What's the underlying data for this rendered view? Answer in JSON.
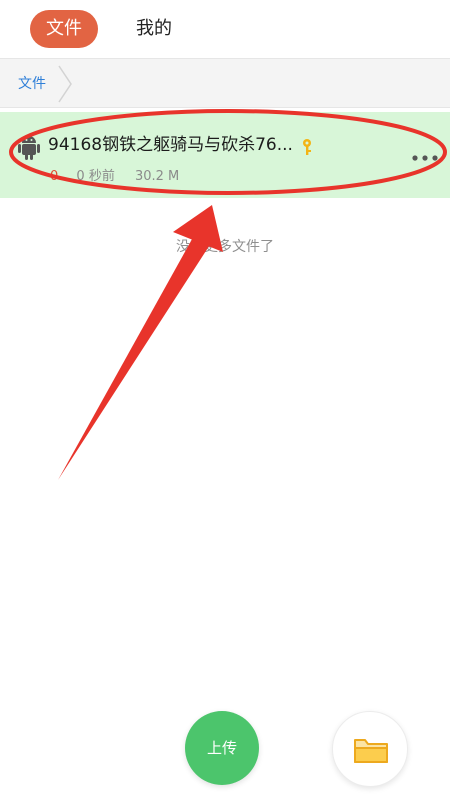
{
  "header": {
    "tabs": [
      {
        "label": "文件",
        "active": true
      },
      {
        "label": "我的",
        "active": false
      }
    ]
  },
  "breadcrumb": {
    "label": "文件"
  },
  "file": {
    "name": "94168钢铁之躯骑马与砍杀76...",
    "count": "0",
    "time": "0 秒前",
    "size": "30.2 M",
    "icons": {
      "type": "android-icon",
      "locked": "key-icon",
      "menu": "more-icon"
    }
  },
  "list": {
    "empty_message": "没有更多文件了"
  },
  "actions": {
    "upload_label": "上传",
    "folder_icon": "folder-icon"
  },
  "colors": {
    "accent": "#e26443",
    "row_highlight": "#d8f6d8",
    "upload": "#4cc56c",
    "link": "#2f7fd8",
    "annotation": "#e8342b"
  }
}
